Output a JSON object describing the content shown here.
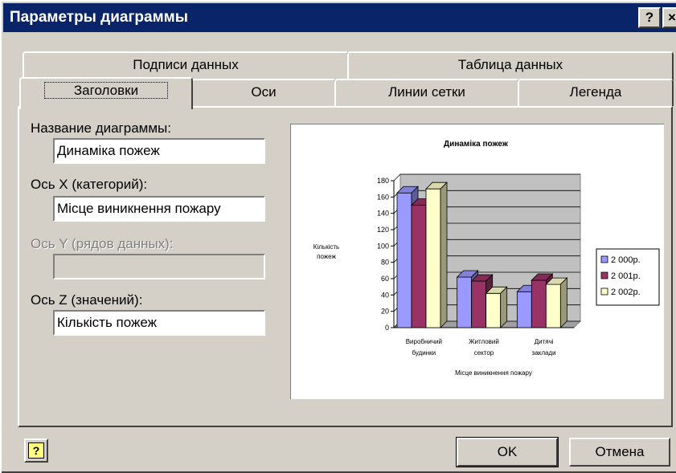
{
  "window": {
    "title": "Параметры диаграммы",
    "help_symbol": "?",
    "close_symbol": "×"
  },
  "tabs": {
    "row1": [
      "Подписи данных",
      "Таблица данных"
    ],
    "row2": [
      "Заголовки",
      "Оси",
      "Линии сетки",
      "Легенда"
    ],
    "active": "Заголовки"
  },
  "fields": {
    "chart_title": {
      "label": "Название диаграммы:",
      "value": "Динаміка пожеж"
    },
    "x_axis": {
      "label": "Ось X (категорий):",
      "value": "Місце виникнення пожару"
    },
    "y_axis": {
      "label": "Ось Y (рядов данных):",
      "value": "",
      "disabled": true
    },
    "z_axis": {
      "label": "Ось Z (значений):",
      "value": "Кількість пожеж"
    }
  },
  "buttons": {
    "ok": "OK",
    "cancel": "Отмена",
    "help_symbol": "?"
  },
  "colors": {
    "title_bar": "#0a246a",
    "dialog_bg": "#d4d0c8",
    "plot_area": "#c0c0c0"
  },
  "chart_data": {
    "type": "bar",
    "style": "3d-column",
    "title": "Динаміка пожеж",
    "xlabel": "Місце виникнення пожару",
    "ylabel": "Кількість пожеж",
    "categories": [
      [
        "Виробничий",
        "будинки"
      ],
      [
        "Житловий",
        "сектор"
      ],
      [
        "Дитячі",
        "заклади"
      ]
    ],
    "series": [
      {
        "name": "2 000р.",
        "values": [
          165,
          62,
          44
        ],
        "color": "#9999ff"
      },
      {
        "name": "2 001р.",
        "values": [
          150,
          57,
          58
        ],
        "color": "#993366"
      },
      {
        "name": "2 002р.",
        "values": [
          170,
          42,
          53
        ],
        "color": "#ffffcc"
      }
    ],
    "ylim": [
      0,
      180
    ],
    "yticks": [
      0,
      20,
      40,
      60,
      80,
      100,
      120,
      140,
      160,
      180
    ],
    "grid": true,
    "legend_position": "right"
  }
}
